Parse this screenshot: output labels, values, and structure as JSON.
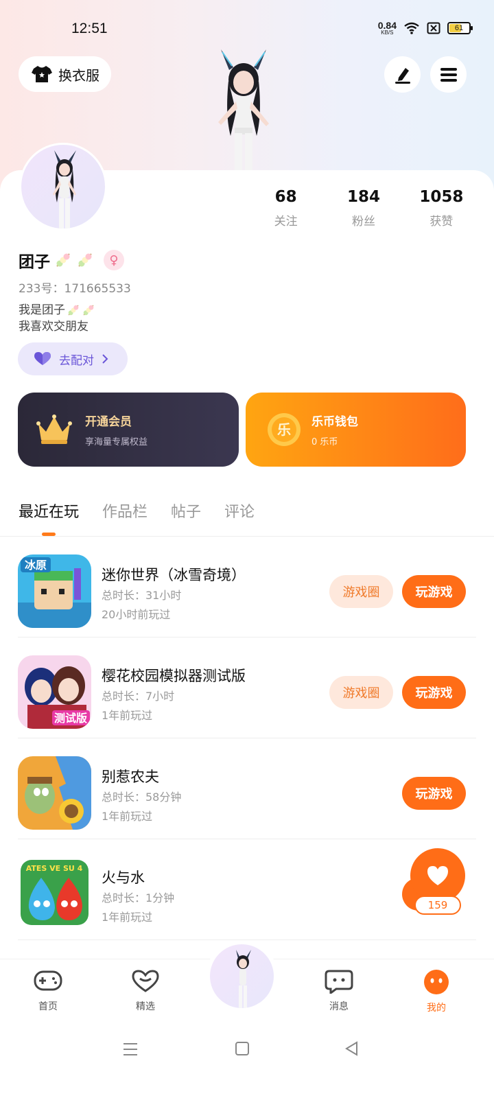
{
  "status_bar": {
    "time": "12:51",
    "net_speed_value": "0.84",
    "net_speed_unit": "KB/S",
    "battery_level": "61"
  },
  "header": {
    "outfit_label": "换衣服",
    "icons": [
      "shirt-icon",
      "edit-icon",
      "menu-icon"
    ]
  },
  "profile": {
    "stats": [
      {
        "value": "68",
        "label": "关注"
      },
      {
        "value": "184",
        "label": "粉丝"
      },
      {
        "value": "1058",
        "label": "获赞"
      }
    ],
    "name": "团子",
    "gender_symbol": "♀",
    "uid": "233号：171665533",
    "bio_line1": "我是团子",
    "bio_line2": "我喜欢交朋友",
    "match_label": "去配对"
  },
  "cards": {
    "vip_title": "开通会员",
    "vip_sub": "享海量专属权益",
    "wallet_title": "乐币钱包",
    "wallet_sub": "0 乐币",
    "coin_glyph": "乐"
  },
  "tabs": [
    "最近在玩",
    "作品栏",
    "帖子",
    "评论"
  ],
  "games": [
    {
      "name": "迷你世界（冰雪奇境）",
      "duration": "总时长：31小时",
      "last_played": "20小时前玩过",
      "circle": "游戏圈",
      "play": "玩游戏",
      "icon_text": "冰原"
    },
    {
      "name": "樱花校园模拟器测试版",
      "duration": "总时长：7小时",
      "last_played": "1年前玩过",
      "circle": "游戏圈",
      "play": "玩游戏",
      "icon_text": "测试版"
    },
    {
      "name": "别惹农夫",
      "duration": "总时长：58分钟",
      "last_played": "1年前玩过",
      "circle": "",
      "play": "玩游戏",
      "icon_text": ""
    },
    {
      "name": "火与水",
      "duration": "总时长：1分钟",
      "last_played": "1年前玩过",
      "circle": "",
      "play": "",
      "icon_text": "ATES VE SU 4"
    }
  ],
  "float_like": {
    "count": "159"
  },
  "bottom_nav": [
    {
      "label": "首页",
      "icon": "gamepad-icon"
    },
    {
      "label": "精选",
      "icon": "heart-chat-icon"
    },
    {
      "label": "消息",
      "icon": "message-icon"
    },
    {
      "label": "我的",
      "icon": "me-icon"
    }
  ],
  "colors": {
    "accent": "#ff6d17",
    "purple": "#6a55d8",
    "vip_gold": "#f6d49a"
  }
}
